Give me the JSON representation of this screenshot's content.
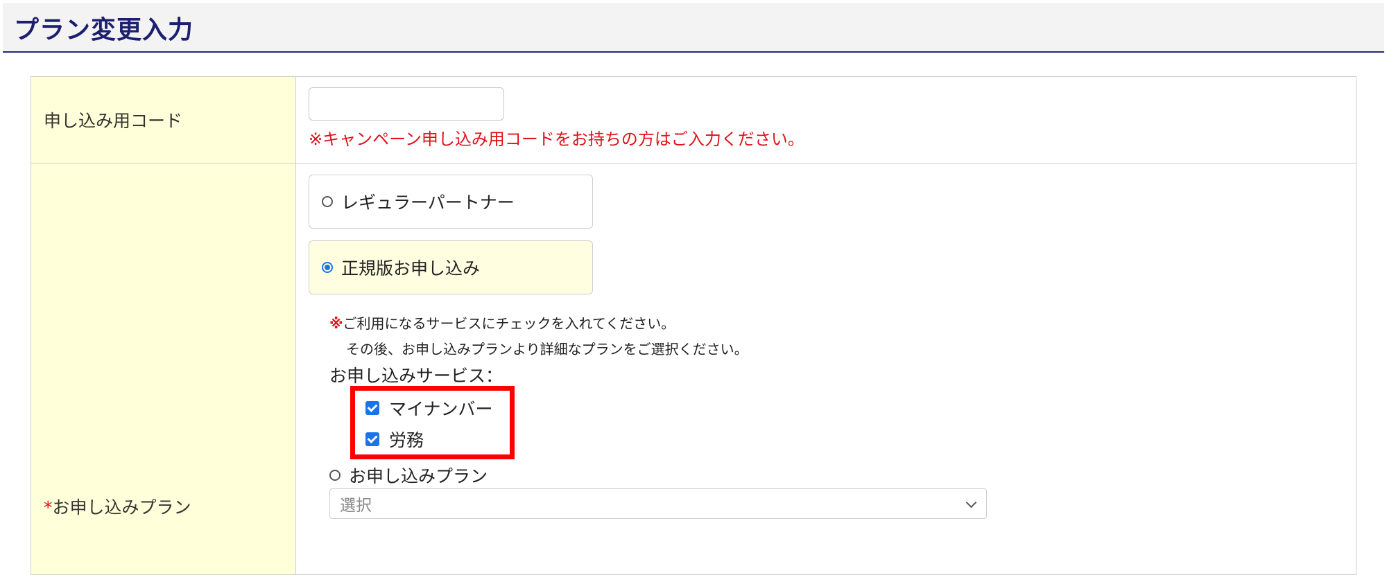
{
  "header": {
    "title": "プラン変更入力"
  },
  "rows": {
    "code": {
      "label": "申し込み用コード",
      "input_value": "",
      "input_placeholder": "",
      "note": "※キャンペーン申し込み用コードをお持ちの方はご入力ください。"
    },
    "plan": {
      "required_mark": "*",
      "label": "お申し込みプラン",
      "options": [
        {
          "label": "レギュラーパートナー",
          "selected": false
        },
        {
          "label": "正規版お申し込み",
          "selected": true
        }
      ],
      "note_mark": "※",
      "note_line1": "ご利用になるサービスにチェックを入れてください。",
      "note_line2": "その後、お申し込みプランより詳細なプランをご選択ください。",
      "service_label": "お申し込みサービス：",
      "services": [
        {
          "label": "マイナンバー",
          "checked": true
        },
        {
          "label": "労務",
          "checked": true
        }
      ],
      "plan_radio_label": "お申し込みプラン",
      "select_value": "選択"
    }
  },
  "colors": {
    "title": "#1b1f6e",
    "label_bg": "#ffffd9",
    "selected_bg": "#fffee0",
    "accent": "#1a73e8",
    "warning": "#e0121b",
    "highlight": "#ff0000"
  }
}
